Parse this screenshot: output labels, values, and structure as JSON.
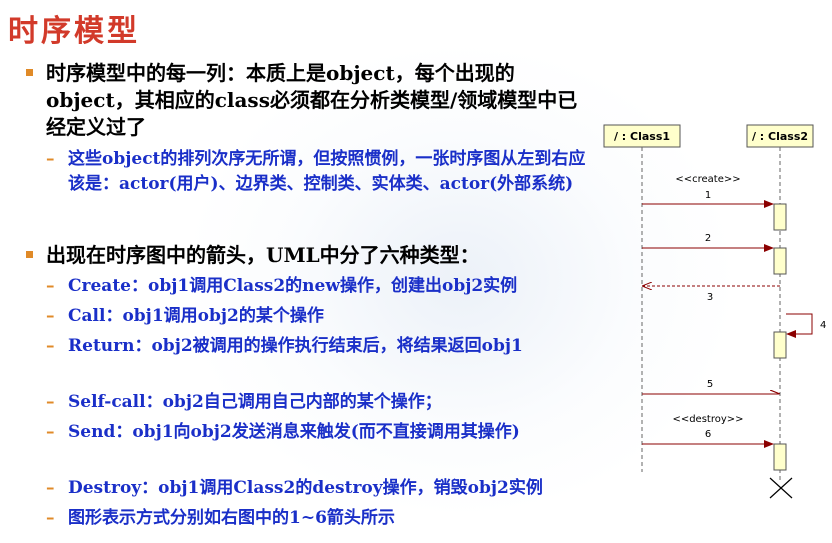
{
  "title": "时序模型",
  "bullets": [
    "时序模型中的每一列：本质上是object，每个出现的object，其相应的class必须都在分析类模型/领域模型中已经定义过了",
    "出现在时序图中的箭头，UML中分了六种类型："
  ],
  "sub_items": [
    "这些object的排列次序无所谓，但按照惯例，一张时序图从左到右应该是：actor(用户)、边界类、控制类、实体类、actor(外部系统)",
    "Create：obj1调用Class2的new操作，创建出obj2实例",
    "Call：obj1调用obj2的某个操作",
    "Return：obj2被调用的操作执行结束后，将结果返回obj1",
    "Self-call：obj2自己调用自己内部的某个操作；",
    "Send：obj1向obj2发送消息来触发(而不直接调用其操作)",
    "Destroy：obj1调用Class2的destroy操作，销毁obj2实例",
    "图形表示方式分别如右图中的1~6箭头所示"
  ],
  "diagram": {
    "lifeline1": "/ : Class1",
    "lifeline2": "/ : Class2",
    "create_stereotype": "<<create>>",
    "destroy_stereotype": "<<destroy>>",
    "msg1": "1",
    "msg2": "2",
    "msg3": "3",
    "msg4": "4",
    "msg5": "5",
    "msg6": "6"
  },
  "colors": {
    "title": "#d23a2a",
    "bullet_marker": "#e08a28",
    "sub_text": "#1a2fc8",
    "lifeline_box": "#ffffcc",
    "arrow": "#8b0000"
  }
}
